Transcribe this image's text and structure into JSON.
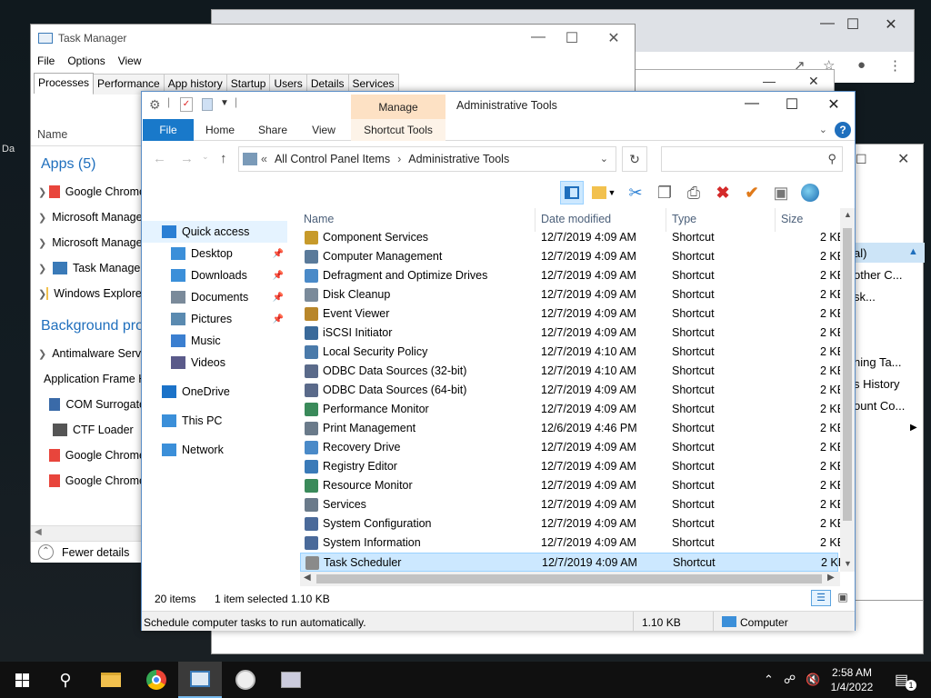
{
  "desktop": {
    "label": "Da"
  },
  "task_manager": {
    "title": "Task Manager",
    "menu": [
      "File",
      "Options",
      "View"
    ],
    "tabs": [
      "Processes",
      "Performance",
      "App history",
      "Startup",
      "Users",
      "Details",
      "Services"
    ],
    "active_tab": "Processes",
    "column_name": "Name",
    "apps_group": "Apps (5)",
    "apps": [
      {
        "name": "Google Chrome",
        "color": "#e8453c"
      },
      {
        "name": "Microsoft Management Console",
        "color": "#b02020"
      },
      {
        "name": "Microsoft Management Console",
        "color": "#b02020"
      },
      {
        "name": "Task Manager",
        "color": "#3a7ab8"
      },
      {
        "name": "Windows Explorer",
        "color": "#f2c14e"
      }
    ],
    "background_group": "Background processes",
    "background": [
      {
        "name": "Antimalware Service Executable",
        "color": "#3a6aa8",
        "expandable": true
      },
      {
        "name": "Application Frame Host",
        "color": "#3a6aa8",
        "expandable": false
      },
      {
        "name": "COM Surrogate",
        "color": "#3a6aa8",
        "expandable": false
      },
      {
        "name": "CTF Loader",
        "color": "#555555",
        "expandable": false
      },
      {
        "name": "Google Chrome",
        "color": "#e8453c",
        "expandable": false
      },
      {
        "name": "Google Chrome",
        "color": "#e8453c",
        "expandable": false
      }
    ],
    "fewer_details": "Fewer details"
  },
  "right_window": {
    "lines": [
      "al)",
      "other C...",
      "sk...",
      "ning Ta...",
      "s History",
      "ount Co..."
    ]
  },
  "explorer": {
    "title": "Administrative Tools",
    "manage_tab": "Manage",
    "ribbon_tabs": [
      "File",
      "Home",
      "Share",
      "View",
      "Shortcut Tools"
    ],
    "address": [
      "All Control Panel Items",
      "Administrative Tools"
    ],
    "address_prefix": "«",
    "nav": [
      {
        "label": "Quick access",
        "icon": "#2a7fd4",
        "pinned": false,
        "selected": true
      },
      {
        "label": "Desktop",
        "icon": "#3b8fd9",
        "pinned": true
      },
      {
        "label": "Downloads",
        "icon": "#3b8fd9",
        "pinned": true
      },
      {
        "label": "Documents",
        "icon": "#7a8a9a",
        "pinned": true
      },
      {
        "label": "Pictures",
        "icon": "#5a8ab0",
        "pinned": true
      },
      {
        "label": "Music",
        "icon": "#3b7fd0",
        "pinned": false
      },
      {
        "label": "Videos",
        "icon": "#5a5a8a",
        "pinned": false
      },
      {
        "label": "OneDrive",
        "icon": "#1b72c8",
        "pinned": false
      },
      {
        "label": "This PC",
        "icon": "#3b8fd9",
        "pinned": false
      },
      {
        "label": "Network",
        "icon": "#3b8fd9",
        "pinned": false
      }
    ],
    "columns": [
      "Name",
      "Date modified",
      "Type",
      "Size"
    ],
    "files": [
      {
        "name": "Component Services",
        "date": "12/7/2019 4:09 AM",
        "type": "Shortcut",
        "size": "2 KB",
        "color": "#c79a2a"
      },
      {
        "name": "Computer Management",
        "date": "12/7/2019 4:09 AM",
        "type": "Shortcut",
        "size": "2 KB",
        "color": "#5a7a9a"
      },
      {
        "name": "Defragment and Optimize Drives",
        "date": "12/7/2019 4:09 AM",
        "type": "Shortcut",
        "size": "2 KB",
        "color": "#4a8ac8"
      },
      {
        "name": "Disk Cleanup",
        "date": "12/7/2019 4:09 AM",
        "type": "Shortcut",
        "size": "2 KB",
        "color": "#7a8a9a"
      },
      {
        "name": "Event Viewer",
        "date": "12/7/2019 4:09 AM",
        "type": "Shortcut",
        "size": "2 KB",
        "color": "#b8862a"
      },
      {
        "name": "iSCSI Initiator",
        "date": "12/7/2019 4:09 AM",
        "type": "Shortcut",
        "size": "2 KB",
        "color": "#3a6a9a"
      },
      {
        "name": "Local Security Policy",
        "date": "12/7/2019 4:10 AM",
        "type": "Shortcut",
        "size": "2 KB",
        "color": "#4a7aaa"
      },
      {
        "name": "ODBC Data Sources (32-bit)",
        "date": "12/7/2019 4:10 AM",
        "type": "Shortcut",
        "size": "2 KB",
        "color": "#5a6a8a"
      },
      {
        "name": "ODBC Data Sources (64-bit)",
        "date": "12/7/2019 4:09 AM",
        "type": "Shortcut",
        "size": "2 KB",
        "color": "#5a6a8a"
      },
      {
        "name": "Performance Monitor",
        "date": "12/7/2019 4:09 AM",
        "type": "Shortcut",
        "size": "2 KB",
        "color": "#3a8a5a"
      },
      {
        "name": "Print Management",
        "date": "12/6/2019 4:46 PM",
        "type": "Shortcut",
        "size": "2 KB",
        "color": "#6a7a8a"
      },
      {
        "name": "Recovery Drive",
        "date": "12/7/2019 4:09 AM",
        "type": "Shortcut",
        "size": "2 KB",
        "color": "#4a8ac8"
      },
      {
        "name": "Registry Editor",
        "date": "12/7/2019 4:09 AM",
        "type": "Shortcut",
        "size": "2 KB",
        "color": "#3a7ab8"
      },
      {
        "name": "Resource Monitor",
        "date": "12/7/2019 4:09 AM",
        "type": "Shortcut",
        "size": "2 KB",
        "color": "#3a8a5a"
      },
      {
        "name": "Services",
        "date": "12/7/2019 4:09 AM",
        "type": "Shortcut",
        "size": "2 KB",
        "color": "#6a7a8a"
      },
      {
        "name": "System Configuration",
        "date": "12/7/2019 4:09 AM",
        "type": "Shortcut",
        "size": "2 KB",
        "color": "#4a6a9a"
      },
      {
        "name": "System Information",
        "date": "12/7/2019 4:09 AM",
        "type": "Shortcut",
        "size": "2 KB",
        "color": "#4a6a9a"
      },
      {
        "name": "Task Scheduler",
        "date": "12/7/2019 4:09 AM",
        "type": "Shortcut",
        "size": "2 KB",
        "color": "#8a8a8a",
        "selected": true
      }
    ],
    "status": {
      "items": "20 items",
      "selected": "1 item selected",
      "size": "1.10 KB"
    },
    "info": {
      "text": "Schedule computer tasks to run automatically.",
      "size": "1.10 KB",
      "location": "Computer"
    }
  },
  "taskbar": {
    "time": "2:58 AM",
    "date": "1/4/2022",
    "notifications": "1"
  }
}
